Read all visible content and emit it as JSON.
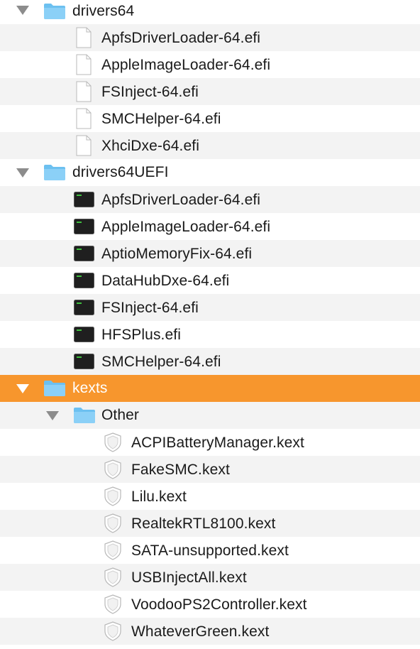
{
  "tree": {
    "drivers64": {
      "name": "drivers64",
      "files": [
        "ApfsDriverLoader-64.efi",
        "AppleImageLoader-64.efi",
        "FSInject-64.efi",
        "SMCHelper-64.efi",
        "XhciDxe-64.efi"
      ]
    },
    "drivers64uefi": {
      "name": "drivers64UEFI",
      "files": [
        "ApfsDriverLoader-64.efi",
        "AppleImageLoader-64.efi",
        "AptioMemoryFix-64.efi",
        "DataHubDxe-64.efi",
        "FSInject-64.efi",
        "HFSPlus.efi",
        "SMCHelper-64.efi"
      ]
    },
    "kexts": {
      "name": "kexts",
      "selected": true,
      "other": {
        "name": "Other",
        "files": [
          "ACPIBatteryManager.kext",
          "FakeSMC.kext",
          "Lilu.kext",
          "RealtekRTL8100.kext",
          "SATA-unsupported.kext",
          "USBInjectAll.kext",
          "VoodooPS2Controller.kext",
          "WhateverGreen.kext"
        ]
      }
    }
  },
  "icons": {
    "disclosure": "disclosure-triangle-expanded-icon",
    "folder": "folder-icon",
    "document": "document-icon",
    "executable": "terminal-executable-icon",
    "kext": "kernel-extension-icon"
  },
  "colors": {
    "selection": "#f7962d",
    "folder": "#6cc0f0",
    "stripe": "#f3f3f3",
    "text": "#1a1a1a"
  }
}
